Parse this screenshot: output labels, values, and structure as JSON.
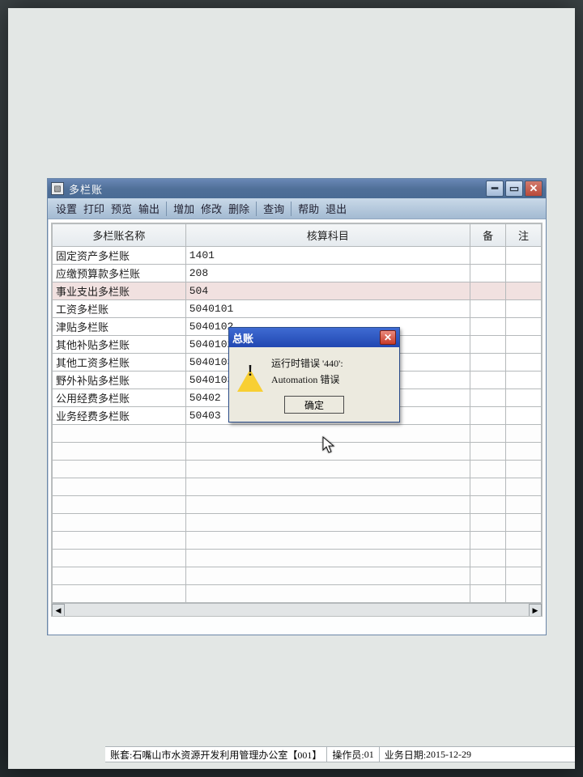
{
  "window": {
    "title": "多栏账",
    "menu": {
      "settings": "设置",
      "print": "打印",
      "preview": "预览",
      "export": "输出",
      "add": "增加",
      "edit": "修改",
      "delete": "删除",
      "query": "查询",
      "help": "帮助",
      "exit": "退出"
    },
    "columns": {
      "name": "多栏账名称",
      "subject": "核算科目",
      "bei": "备",
      "zhu": "注"
    },
    "rows": [
      {
        "name": "固定资产多栏账",
        "code": "1401"
      },
      {
        "name": "应缴预算款多栏账",
        "code": "208"
      },
      {
        "name": "事业支出多栏账",
        "code": "504"
      },
      {
        "name": "工资多栏账",
        "code": "5040101"
      },
      {
        "name": "津贴多栏账",
        "code": "5040102"
      },
      {
        "name": "其他补贴多栏账",
        "code": "504010209"
      },
      {
        "name": "其他工资多栏账",
        "code": "5040103"
      },
      {
        "name": "野外补贴多栏账",
        "code": "504010303"
      },
      {
        "name": "公用经费多栏账",
        "code": "50402"
      },
      {
        "name": "业务经费多栏账",
        "code": "50403"
      }
    ],
    "selected_index": 2
  },
  "dialog": {
    "title": "总账",
    "line1": "运行时错误 '440':",
    "line2": "Automation 错误",
    "ok": "确定"
  },
  "statusbar": {
    "account_label": "账套:",
    "account_value": "石嘴山市水资源开发利用管理办公室【001】",
    "operator_label": "操作员:",
    "operator_value": "01",
    "date_label": "业务日期:",
    "date_value": "2015-12-29"
  }
}
